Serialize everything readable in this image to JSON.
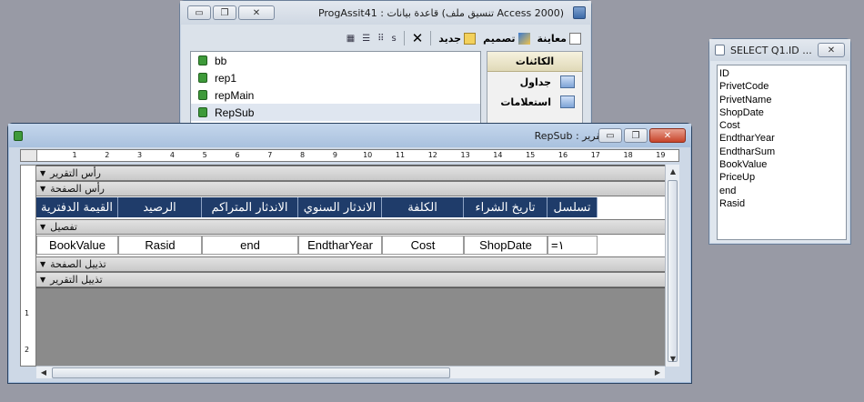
{
  "db_window": {
    "title": "ProgAssit41 : قاعدة بيانات (تنسيق ملف Access 2000)",
    "toolbar": {
      "preview": "معاينة",
      "design": "تصميم",
      "new": "جديد"
    },
    "objects_header": "الكائنات",
    "objects": [
      {
        "label": "جداول",
        "icon": "table-icon"
      },
      {
        "label": "استعلامات",
        "icon": "query-icon"
      }
    ],
    "items": [
      "bb",
      "rep1",
      "repMain",
      "RepSub"
    ]
  },
  "select_window": {
    "title": "SELECT Q1.ID ...",
    "fields": [
      "ID",
      "PrivetCode",
      "PrivetName",
      "ShopDate",
      "Cost",
      "EndtharYear",
      "EndtharSum",
      "BookValue",
      "PriceUp",
      "end",
      "Rasid"
    ]
  },
  "report_window": {
    "title": "RepSub : تقرير",
    "ruler_numbers": [
      "1",
      "2",
      "3",
      "4",
      "5",
      "6",
      "7",
      "8",
      "9",
      "10",
      "11",
      "12",
      "13",
      "14",
      "15",
      "16",
      "17",
      "18",
      "19"
    ],
    "vruler_numbers": [
      "1",
      "2"
    ],
    "bands": {
      "report_header": "رأس التقرير",
      "page_header": "رأس الصفحة",
      "detail": "تفصيل",
      "page_footer": "تذييل الصفحة",
      "report_footer": "تذييل التقرير"
    },
    "headers": [
      "القيمة الدفترية",
      "الرصيد",
      "الاندثار المتراكم",
      "الاندثار السنوي",
      "الكلفة",
      "تاريخ الشراء",
      "تسلسل"
    ],
    "details": [
      "BookValue",
      "Rasid",
      "end",
      "EndtharYear",
      "Cost",
      "ShopDate",
      "=١"
    ]
  },
  "colors": {
    "header_fill": "#1f3c6a",
    "desktop": "#989aa5"
  }
}
